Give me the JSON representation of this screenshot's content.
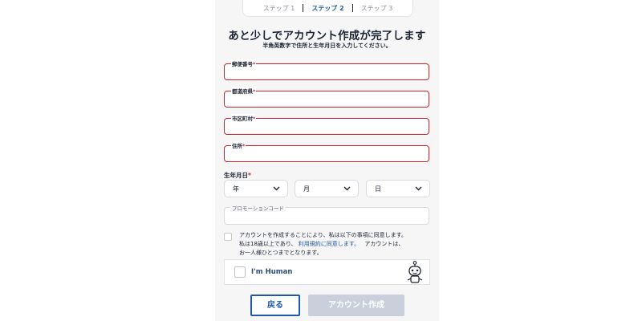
{
  "steps": [
    {
      "label": "ステップ 1"
    },
    {
      "label": "ステップ 2"
    },
    {
      "label": "ステップ 3"
    }
  ],
  "heading": {
    "title": "あと少しでアカウント作成が完了します",
    "subtitle": "半角英数字で住所と生年月日を入力してください。"
  },
  "fields": {
    "postal_code": {
      "label": "郵便番号",
      "value": ""
    },
    "prefecture": {
      "label": "都道府県",
      "value": ""
    },
    "city": {
      "label": "市区町村",
      "value": ""
    },
    "address": {
      "label": "住所",
      "value": ""
    }
  },
  "required_mark": "*",
  "dob": {
    "label": "生年月日",
    "year": "年",
    "month": "月",
    "day": "日"
  },
  "promo": {
    "label": "プロモーションコード",
    "value": ""
  },
  "agreement": {
    "line1": "アカウントを作成することにより、私は以下の事項に同意します。",
    "line2_prefix": "私は18歳以上であり、",
    "terms_link": "利用規約に同意します。",
    "line2_suffix": "アカウントは、",
    "line3": "お一人様ひとつまでとなります。"
  },
  "captcha": {
    "label": "I'm Human",
    "icon": "robot-icon"
  },
  "buttons": {
    "back": "戻る",
    "create": "アカウント作成"
  },
  "colors": {
    "accent": "#1f5aa8",
    "error": "#c8232c",
    "disabled_button": "#c9cfdb"
  }
}
